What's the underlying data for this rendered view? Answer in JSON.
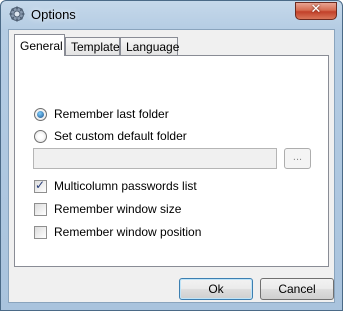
{
  "window": {
    "title": "Options"
  },
  "tabs": [
    {
      "label": "General",
      "active": true
    },
    {
      "label": "Template",
      "active": false
    },
    {
      "label": "Language",
      "active": false
    }
  ],
  "general": {
    "remember_last_folder": {
      "label": "Remember last folder",
      "checked": true
    },
    "custom_folder": {
      "label": "Set custom default folder",
      "checked": false
    },
    "folder_path": {
      "value": "",
      "placeholder": ""
    },
    "browse_label": "...",
    "multicolumn": {
      "label": "Multicolumn passwords list",
      "checked": true
    },
    "remember_size": {
      "label": "Remember window size",
      "checked": false
    },
    "remember_position": {
      "label": "Remember window position",
      "checked": false
    }
  },
  "buttons": {
    "ok": "Ok",
    "cancel": "Cancel"
  },
  "icons": {
    "app": "gear-icon",
    "close": "close-icon"
  },
  "colors": {
    "accent": "#1c4f8a",
    "titlebar": "#b4cce3",
    "close": "#c2412a"
  }
}
